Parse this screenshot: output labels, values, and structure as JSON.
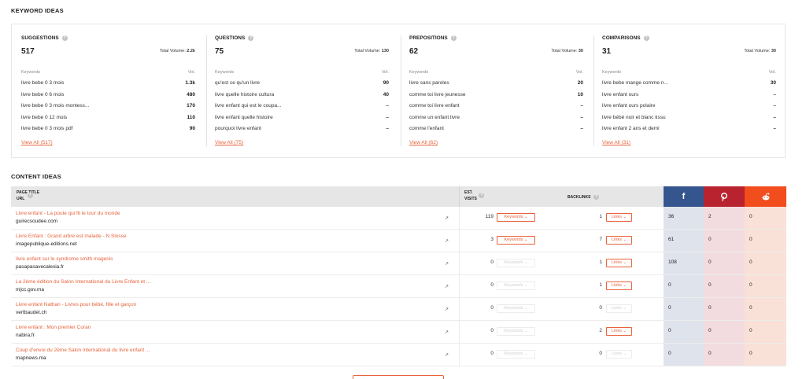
{
  "keyword_ideas": {
    "title": "KEYWORD IDEAS",
    "columns": [
      {
        "name": "SUGGESTIONS",
        "count": "517",
        "total_label": "Total Volume:",
        "total_value": "2.2k",
        "kw_label": "Keywords",
        "vol_label": "Vol.",
        "rows": [
          [
            "livre bebe 0 3 mois",
            "1.3k"
          ],
          [
            "livre bebe 0 6 mois",
            "480"
          ],
          [
            "livre bebe 0 3 mois montess...",
            "170"
          ],
          [
            "livre bebe 0 12 mois",
            "110"
          ],
          [
            "livre bebe 0 3 mois pdf",
            "90"
          ]
        ],
        "view_all": "View All (517)"
      },
      {
        "name": "QUESTIONS",
        "count": "75",
        "total_label": "Total Volume:",
        "total_value": "130",
        "kw_label": "Keywords",
        "vol_label": "Vol.",
        "rows": [
          [
            "qu'est ce qu'un livre",
            "90"
          ],
          [
            "livre quelle histoire cultura",
            "40"
          ],
          [
            "livre enfant qui est le coupa...",
            "–"
          ],
          [
            "livre enfant quelle histoire",
            "–"
          ],
          [
            "pourquoi livre enfant",
            "–"
          ]
        ],
        "view_all": "View All (75)"
      },
      {
        "name": "PREPOSITIONS",
        "count": "62",
        "total_label": "Total Volume:",
        "total_value": "30",
        "kw_label": "Keywords",
        "vol_label": "Vol.",
        "rows": [
          [
            "livre sans paroles",
            "20"
          ],
          [
            "comme toi livre jeunesse",
            "10"
          ],
          [
            "comme toi livre enfant",
            "–"
          ],
          [
            "comme un enfant livre",
            "–"
          ],
          [
            "comme l'enfant",
            "–"
          ]
        ],
        "view_all": "View All (62)"
      },
      {
        "name": "COMPARISONS",
        "count": "31",
        "total_label": "Total Volume:",
        "total_value": "30",
        "kw_label": "Keywords",
        "vol_label": "Vol.",
        "rows": [
          [
            "livre bebe mange comme n...",
            "30"
          ],
          [
            "livre enfant ours",
            "–"
          ],
          [
            "livre enfant ours polaire",
            "–"
          ],
          [
            "livre bébé noir et blanc tissu",
            "–"
          ],
          [
            "livre enfant 2 ans et demi",
            "–"
          ]
        ],
        "view_all": "View All (31)"
      }
    ]
  },
  "content_ideas": {
    "title": "CONTENT IDEAS",
    "headers": {
      "page_title": "PAGE TITLE",
      "url": "URL",
      "est": "EST.",
      "visits": "VISITS",
      "backlinks": "BACKLINKS",
      "facebook_icon": "facebook-icon",
      "pinterest_icon": "pinterest-icon",
      "reddit_icon": "reddit-icon"
    },
    "keywords_btn": "Keywords ⌄",
    "links_btn": "Links ⌄",
    "rows": [
      {
        "title": "Livre enfant - La poule qui fit le tour du monde",
        "url": "guirecsoudee.com",
        "visits": "119",
        "backlinks": "1",
        "kw_active": true,
        "links_active": true,
        "fb": "36",
        "pi": "2",
        "rd": "0"
      },
      {
        "title": "Livre Enfant : Grand arbre est malade - N Slosse",
        "url": "imagepublique-editions.net",
        "visits": "3",
        "backlinks": "7",
        "kw_active": true,
        "links_active": true,
        "fb": "61",
        "pi": "0",
        "rd": "0"
      },
      {
        "title": "livre enfant sur le syndrome smith magenis",
        "url": "pasapasavecalexia.fr",
        "visits": "0",
        "backlinks": "1",
        "kw_active": false,
        "links_active": true,
        "fb": "108",
        "pi": "0",
        "rd": "0"
      },
      {
        "title": "La 2ème édition du Salon International du Livre Enfant et ...",
        "url": "mjcc.gov.ma",
        "visits": "0",
        "backlinks": "1",
        "kw_active": false,
        "links_active": true,
        "fb": "0",
        "pi": "0",
        "rd": "0"
      },
      {
        "title": "Livre enfant Nathan - Livres pour bébé, fille et garçon",
        "url": "vertbaudet.ch",
        "visits": "0",
        "backlinks": "0",
        "kw_active": false,
        "links_active": false,
        "fb": "0",
        "pi": "0",
        "rd": "0"
      },
      {
        "title": "Livre enfant : Mon premier Coran",
        "url": "nabira.fr",
        "visits": "0",
        "backlinks": "2",
        "kw_active": false,
        "links_active": true,
        "fb": "0",
        "pi": "0",
        "rd": "0"
      },
      {
        "title": "Coup d'envoi du 2ème Salon international du livre enfant ...",
        "url": "mapnews.ma",
        "visits": "0",
        "backlinks": "0",
        "kw_active": false,
        "links_active": false,
        "fb": "0",
        "pi": "0",
        "rd": "0"
      }
    ]
  },
  "colors": {
    "accent": "#e8633b",
    "facebook": "#35558f",
    "pinterest": "#b8232f",
    "reddit": "#f14d1d"
  }
}
